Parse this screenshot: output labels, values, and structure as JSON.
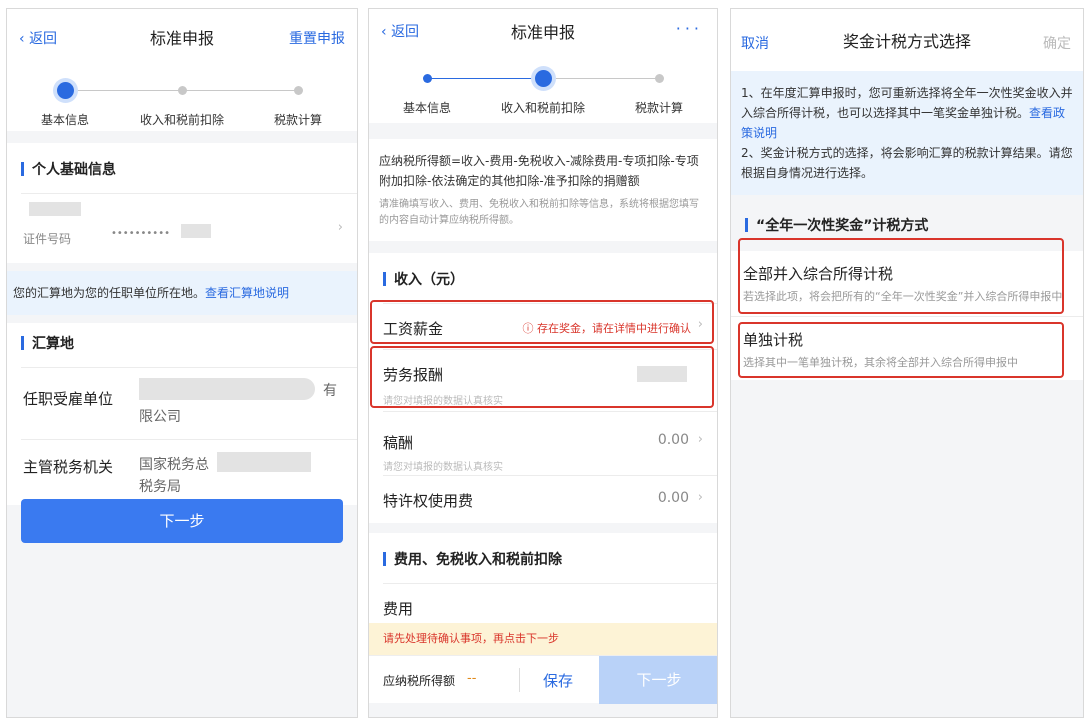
{
  "panel1": {
    "back": "返回",
    "title": "标准申报",
    "reset": "重置申报",
    "steps": [
      "基本信息",
      "收入和税前扣除",
      "税款计算"
    ],
    "personal_title": "个人基础信息",
    "id_label": "证件号码",
    "id_value": "••••••••••",
    "location_tip": "您的汇算地为您的任职单位所在地。",
    "location_link": "查看汇算地说明",
    "region_title": "汇算地",
    "employer_label": "任职受雇单位",
    "employer_value_a": "有",
    "employer_value_b": "限公司",
    "tax_office_label": "主管税务机关",
    "tax_office_value_a": "国家税务总",
    "tax_office_value_b": "税务局",
    "next": "下一步"
  },
  "panel2": {
    "back": "返回",
    "title": "标准申报",
    "dots": "···",
    "steps": [
      "基本信息",
      "收入和税前扣除",
      "税款计算"
    ],
    "formula": "应纳税所得额=收入-费用-免税收入-减除费用-专项扣除-专项附加扣除-依法确定的其他扣除-准予扣除的捐赠额",
    "formula_hint": "请准确填写收入、费用、免税收入和税前扣除等信息，系统将根据您填写的内容自动计算应纳税所得额。",
    "income_title": "收入（元）",
    "items": [
      {
        "label": "工资薪金",
        "value": "存在奖金，请在详情中进行确认",
        "hint": ""
      },
      {
        "label": "劳务报酬",
        "value": "",
        "hint": "请您对填报的数据认真核实"
      },
      {
        "label": "稿酬",
        "value": "0.00",
        "hint": "请您对填报的数据认真核实"
      },
      {
        "label": "特许权使用费",
        "value": "0.00",
        "hint": ""
      }
    ],
    "expense_title": "费用、免税收入和税前扣除",
    "expense_label": "费用",
    "warning": "请先处理待确认事项，再点击下一步",
    "taxable_label": "应纳税所得额",
    "taxable_value": "--",
    "save": "保存",
    "next": "下一步"
  },
  "panel3": {
    "cancel": "取消",
    "title": "奖金计税方式选择",
    "confirm": "确定",
    "tip1": "1、在年度汇算申报时，您可重新选择将全年一次性奖金收入并入综合所得计税，也可以选择其中一笔奖金单独计税。",
    "tip1_link": "查看政策说明",
    "tip2": "2、奖金计税方式的选择，将会影响汇算的税款计算结果。请您根据自身情况进行选择。",
    "section_title": "“全年一次性奖金”计税方式",
    "option1_title": "全部并入综合所得计税",
    "option1_desc": "若选择此项，将会把所有的“全年一次性奖金”并入综合所得申报中",
    "option2_title": "单独计税",
    "option2_desc": "选择其中一笔单独计税，其余将全部并入综合所得申报中"
  },
  "colors": {
    "accent": "#2a6ae0",
    "alert": "#d9352b",
    "warning_bg": "#fdf3d6"
  }
}
